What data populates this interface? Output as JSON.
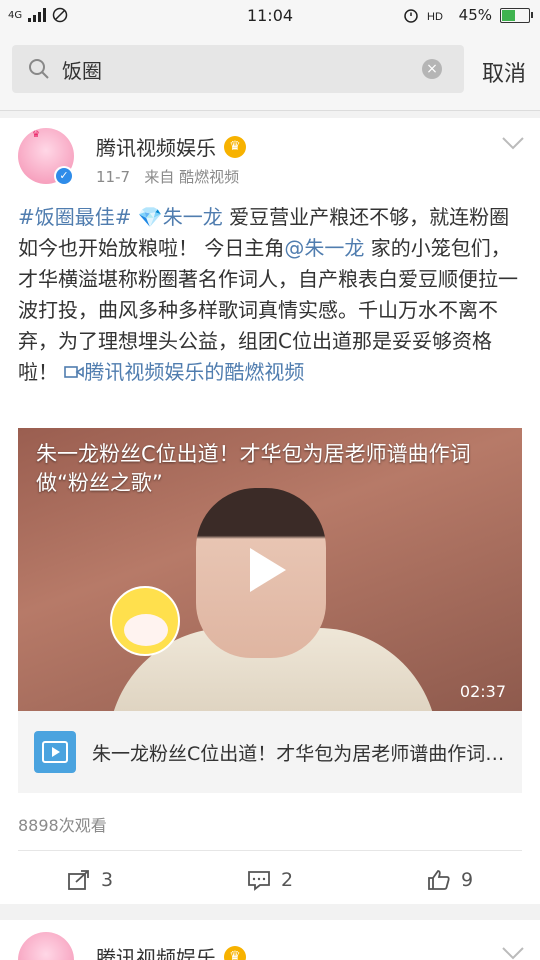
{
  "status": {
    "network": "4G",
    "time": "11:04",
    "battery": "45%",
    "battery_level": 0.45
  },
  "search": {
    "query": "饭圈",
    "cancel_label": "取消"
  },
  "post": {
    "author": "腾讯视频娱乐",
    "date": "11-7",
    "source": "来自 酷燃视频",
    "hashtag": "#饭圈最佳#",
    "topic": "💎朱一龙",
    "text1": " 爱豆营业产粮还不够，就连粉圈如今也开始放粮啦！ 今日主角",
    "mention": "@朱一龙",
    "text2": " 家的小笼包们，才华横溢堪称粉圈著名作词人，自产粮表白爱豆顺便拉一波打投，曲风多种多样歌词真情实感。千山万水不离不弃，为了理想埋头公益，组团C位出道那是妥妥够资格啦！ ",
    "video_link_label": "腾讯视频娱乐的酷燃视频",
    "video_title": "朱一龙粉丝C位出道！才华包为居老师谱曲作词做“粉丝之歌”",
    "duration": "02:37",
    "video_card_title": "朱一龙粉丝C位出道！才华包为居老师谱曲作词做“粉丝之歌”",
    "views": "8898次观看",
    "shares": "3",
    "comments": "2",
    "likes": "9"
  },
  "next_post": {
    "author": "腾讯视频娱乐"
  },
  "colors": {
    "link": "#507daf",
    "verified": "#2f8ce9",
    "battery": "#3fb34f"
  }
}
